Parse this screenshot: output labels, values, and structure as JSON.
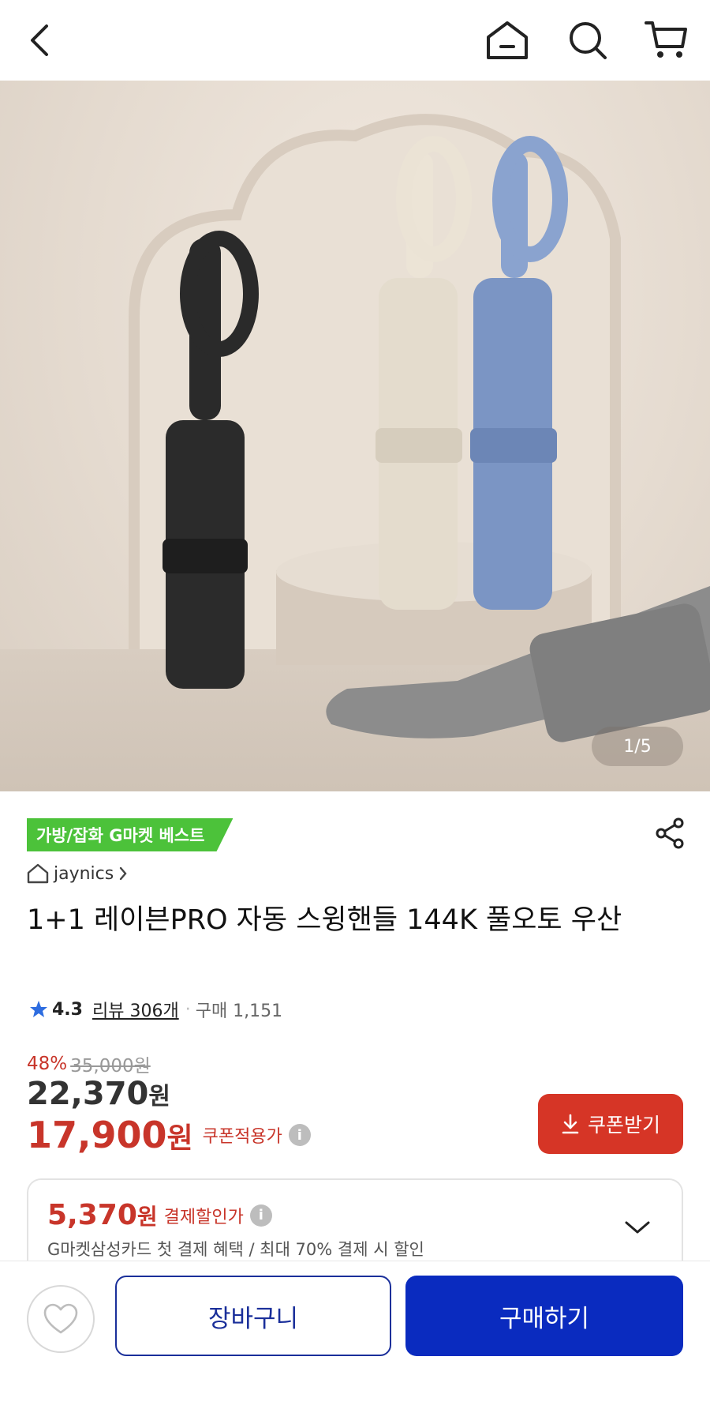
{
  "header": {
    "back_icon": "back-chevron-icon",
    "home_icon": "home-icon",
    "search_icon": "search-icon",
    "cart_icon": "cart-icon"
  },
  "gallery": {
    "counter": "1/5"
  },
  "product": {
    "best_badge": "가방/잡화 G마켓 베스트",
    "seller": "jaynics",
    "title": "1+1 레이븐PRO 자동 스윙핸들 144K 풀오토 우산",
    "rating": "4.3",
    "review_label": "리뷰 306개",
    "separator": "·",
    "purchase_label": "구매 1,151"
  },
  "price": {
    "discount_rate": "48%",
    "original_price": "35,000원",
    "sale_price": "22,370",
    "sale_unit": "원",
    "coupon_price": "17,900",
    "coupon_unit": "원",
    "coupon_label": "쿠폰적용가",
    "coupon_button": "쿠폰받기"
  },
  "payment": {
    "amount": "5,370",
    "unit": "원",
    "label": "결제할인가",
    "description": "G마켓삼성카드 첫 결제 혜택 / 최대 70% 결제 시 할인"
  },
  "bottom": {
    "cart_label": "장바구니",
    "buy_label": "구매하기"
  },
  "colors": {
    "accent_red": "#c8352a",
    "primary_blue": "#0a2bbf",
    "badge_green": "#4cc23a"
  }
}
